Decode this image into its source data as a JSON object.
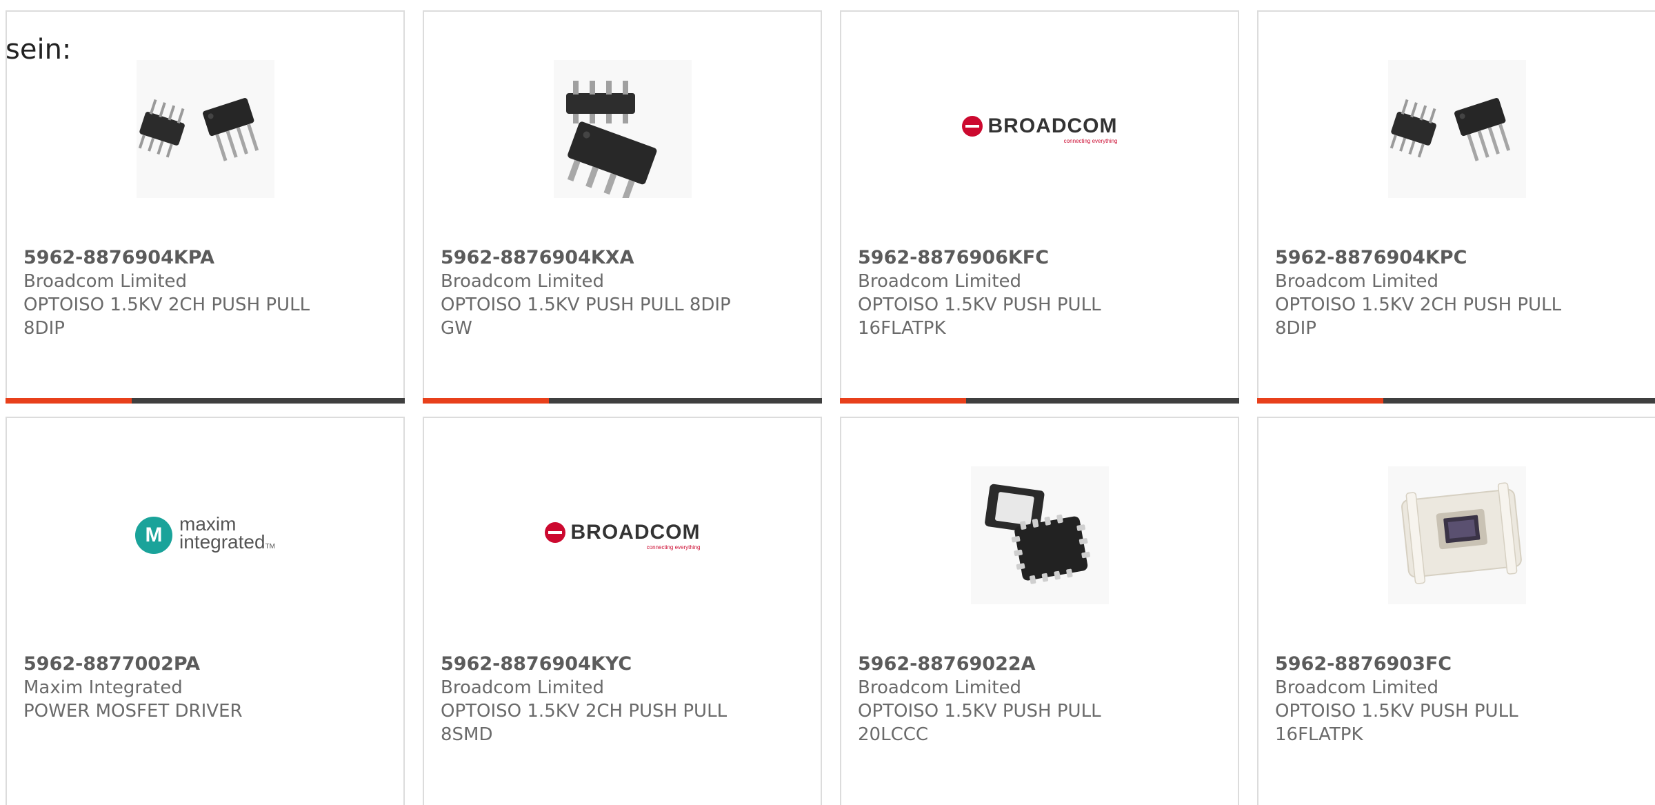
{
  "intro_text": "sein:",
  "colors": {
    "accent": "#e8401b",
    "bar": "#3f3f3f",
    "broadcom_red": "#cc092f",
    "maxim_teal": "#1aa39a"
  },
  "products": [
    {
      "part_number": "5962-8876904KPA",
      "manufacturer": "Broadcom Limited",
      "description_line1": "OPTOISO 1.5KV 2CH PUSH PULL",
      "description_line2": "8DIP",
      "image": "dip-package-photo",
      "accent_bar": true
    },
    {
      "part_number": "5962-8876904KXA",
      "manufacturer": "Broadcom Limited",
      "description_line1": "OPTOISO 1.5KV PUSH PULL 8DIP",
      "description_line2": "GW",
      "image": "gullwing-package-photo",
      "accent_bar": true
    },
    {
      "part_number": "5962-8876906KFC",
      "manufacturer": "Broadcom Limited",
      "description_line1": "OPTOISO 1.5KV PUSH PULL",
      "description_line2": "16FLATPK",
      "image": "broadcom-logo",
      "accent_bar": true
    },
    {
      "part_number": "5962-8876904KPC",
      "manufacturer": "Broadcom Limited",
      "description_line1": "OPTOISO 1.5KV 2CH PUSH PULL",
      "description_line2": "8DIP",
      "image": "dip-package-photo",
      "accent_bar": true
    },
    {
      "part_number": "5962-8877002PA",
      "manufacturer": "Maxim Integrated",
      "description_line1": "POWER MOSFET DRIVER",
      "description_line2": "",
      "image": "maxim-logo",
      "accent_bar": false
    },
    {
      "part_number": "5962-8876904KYC",
      "manufacturer": "Broadcom Limited",
      "description_line1": "OPTOISO 1.5KV 2CH PUSH PULL",
      "description_line2": "8SMD",
      "image": "broadcom-logo",
      "accent_bar": false
    },
    {
      "part_number": "5962-88769022A",
      "manufacturer": "Broadcom Limited",
      "description_line1": "OPTOISO 1.5KV PUSH PULL",
      "description_line2": "20LCCC",
      "image": "lccc-package-photo",
      "accent_bar": false
    },
    {
      "part_number": "5962-8876903FC",
      "manufacturer": "Broadcom Limited",
      "description_line1": "OPTOISO 1.5KV PUSH PULL",
      "description_line2": "16FLATPK",
      "image": "flatpack-package-photo",
      "accent_bar": false
    }
  ],
  "logos": {
    "broadcom_word": "BROADCOM",
    "broadcom_tag": "connecting everything",
    "maxim_word1": "maxim",
    "maxim_word2": "integrated",
    "maxim_tm": "TM"
  }
}
